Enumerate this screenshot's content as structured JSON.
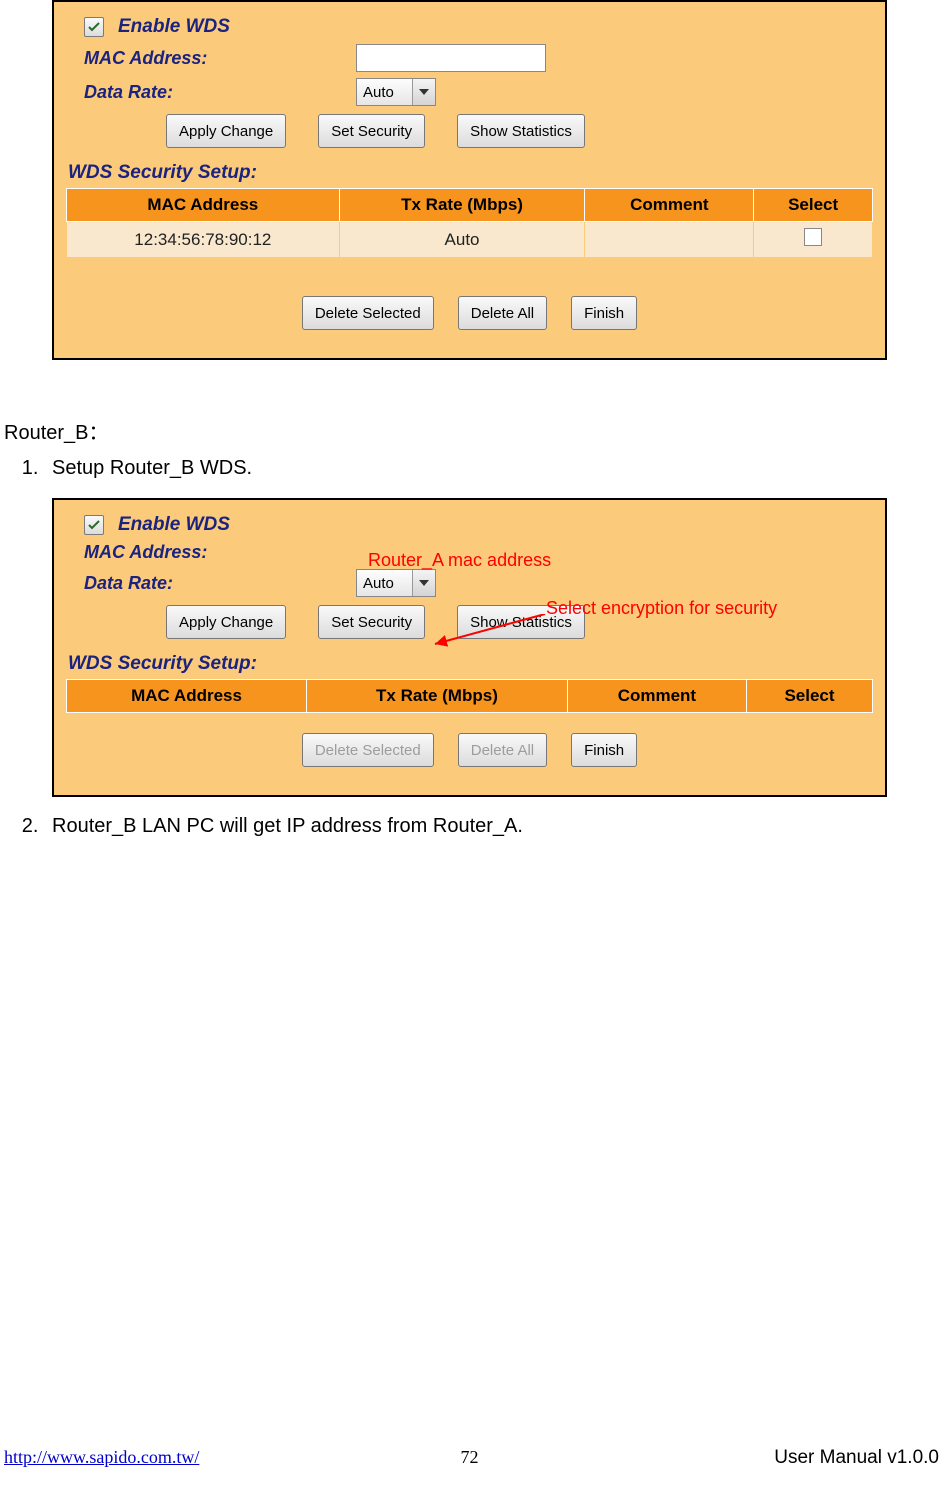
{
  "panel1": {
    "enable_label": "Enable WDS",
    "mac_label": "MAC Address:",
    "mac_value": "",
    "rate_label": "Data Rate:",
    "rate_value": "Auto",
    "buttons": {
      "apply": "Apply Change",
      "set_security": "Set Security",
      "show_stats": "Show Statistics"
    },
    "section": "WDS Security Setup:",
    "table": {
      "headers": [
        "MAC Address",
        "Tx Rate (Mbps)",
        "Comment",
        "Select"
      ],
      "rows": [
        {
          "mac": "12:34:56:78:90:12",
          "tx": "Auto",
          "comment": "",
          "selected": false
        }
      ]
    },
    "bottom_buttons": {
      "del_sel": "Delete Selected",
      "del_all": "Delete All",
      "finish": "Finish"
    }
  },
  "text": {
    "router_b_heading": "Router_B：",
    "step1": "Setup Router_B WDS.",
    "step2": "Router_B LAN PC will get IP address from Router_A."
  },
  "panel2": {
    "enable_label": "Enable WDS",
    "mac_label": "MAC Address:",
    "rate_label": "Data Rate:",
    "rate_value": "Auto",
    "buttons": {
      "apply": "Apply Change",
      "set_security": "Set Security",
      "show_stats": "Show Statistics"
    },
    "section": "WDS Security Setup:",
    "table": {
      "headers": [
        "MAC Address",
        "Tx Rate (Mbps)",
        "Comment",
        "Select"
      ]
    },
    "bottom_buttons": {
      "del_sel": "Delete Selected",
      "del_all": "Delete All",
      "finish": "Finish"
    },
    "annotations": {
      "mac_note": "Router_A mac address",
      "security_note": "Select encryption for security"
    }
  },
  "footer": {
    "url": "http://www.sapido.com.tw/",
    "page": "72",
    "version": "User  Manual  v1.0.0"
  }
}
